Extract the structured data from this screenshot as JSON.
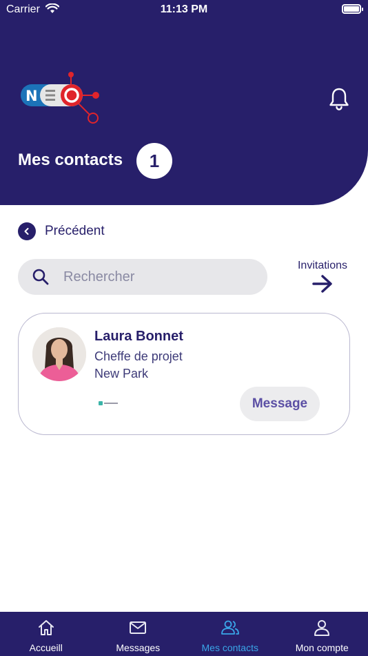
{
  "status_bar": {
    "carrier": "Carrier",
    "time": "11:13 PM"
  },
  "header": {
    "title": "Mes contacts",
    "contact_count": "1"
  },
  "back": {
    "label": "Précédent"
  },
  "search": {
    "placeholder": "Rechercher"
  },
  "invitations": {
    "label": "Invitations"
  },
  "contacts": [
    {
      "name": "Laura Bonnet",
      "role": "Cheffe de projet",
      "company": "New Park",
      "message_label": "Message"
    }
  ],
  "tabbar": {
    "items": [
      {
        "label": "Accueill",
        "icon": "home-icon"
      },
      {
        "label": "Messages",
        "icon": "mail-icon"
      },
      {
        "label": "Mes contacts",
        "icon": "contacts-icon",
        "active": true
      },
      {
        "label": "Mon compte",
        "icon": "user-icon"
      }
    ]
  },
  "colors": {
    "primary": "#271f6a",
    "accent": "#3aa6e8",
    "logo_red": "#e0242b",
    "logo_blue": "#1c73b8"
  }
}
